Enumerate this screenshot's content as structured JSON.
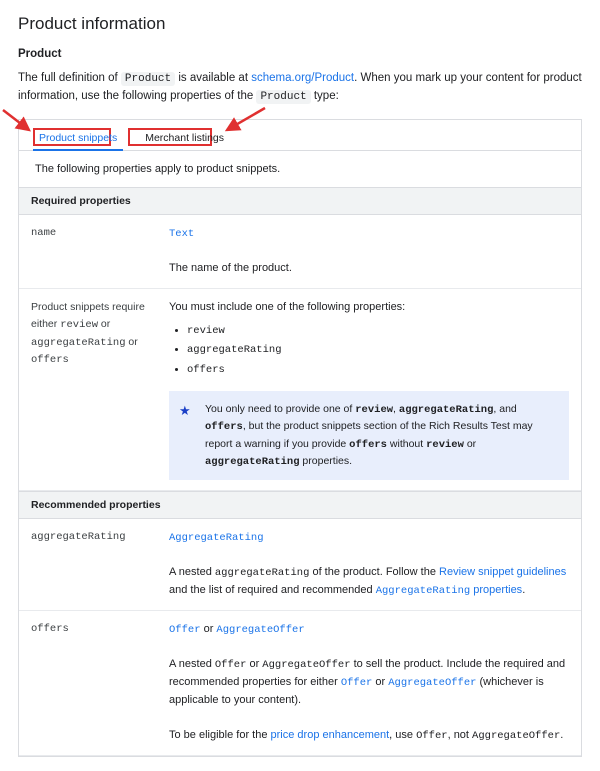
{
  "title": "Product information",
  "subheading": "Product",
  "intro": {
    "pre": "The full definition of ",
    "code": "Product",
    "mid": " is available at ",
    "link": "schema.org/Product",
    "post1": ". When you mark up your content for product information, use the following properties of the ",
    "code2": "Product",
    "post2": " type:"
  },
  "tabs": {
    "a": "Product snippets",
    "b": "Merchant listings",
    "info": "The following properties apply to product snippets."
  },
  "required": {
    "head": "Required properties",
    "name": {
      "key": "name",
      "type": "Text",
      "desc": "The name of the product."
    },
    "req": {
      "key_pre": "Product snippets require either ",
      "k1": "review",
      "k_or1": " or ",
      "k2": "aggregateRating",
      "k_or2": " or ",
      "k3": "offers",
      "lead": "You must include one of the following properties:",
      "b1": "review",
      "b2": "aggregateRating",
      "b3": "offers",
      "note_pre": "You only need to provide one of ",
      "n1": "review",
      "c1": ", ",
      "n2": "aggregateRating",
      "c2": ", and ",
      "n3": "offers",
      "note_mid": ", but the product snippets section of the Rich Results Test may report a warning if you provide ",
      "n4": "offers",
      "note_mid2": " without ",
      "n5": "review",
      "c3": " or ",
      "n6": "aggregateRating",
      "note_end": " properties."
    }
  },
  "recommended": {
    "head": "Recommended properties",
    "agg": {
      "key": "aggregateRating",
      "type": "AggregateRating",
      "d1": "A nested ",
      "dm": "aggregateRating",
      "d2": " of the product. Follow the ",
      "l1": "Review snippet guidelines",
      "d3": " and the list of required and recommended ",
      "l2": "AggregateRating",
      "d4": " properties",
      "d5": "."
    },
    "off": {
      "key": "offers",
      "t1": "Offer",
      "tor": " or ",
      "t2": "AggregateOffer",
      "d1": "A nested ",
      "m1": "Offer",
      "d1b": " or ",
      "m2": "AggregateOffer",
      "d2": " to sell the product. Include the required and recommended properties for either ",
      "l1": "Offer",
      "d3": " or ",
      "l2": "AggregateOffer",
      "d4": " (whichever is applicable to your content).",
      "e1": "To be eligible for the ",
      "el": "price drop enhancement",
      "e2": ", use ",
      "em1": "Offer",
      "e3": ", not ",
      "em2": "AggregateOffer",
      "e4": "."
    }
  }
}
